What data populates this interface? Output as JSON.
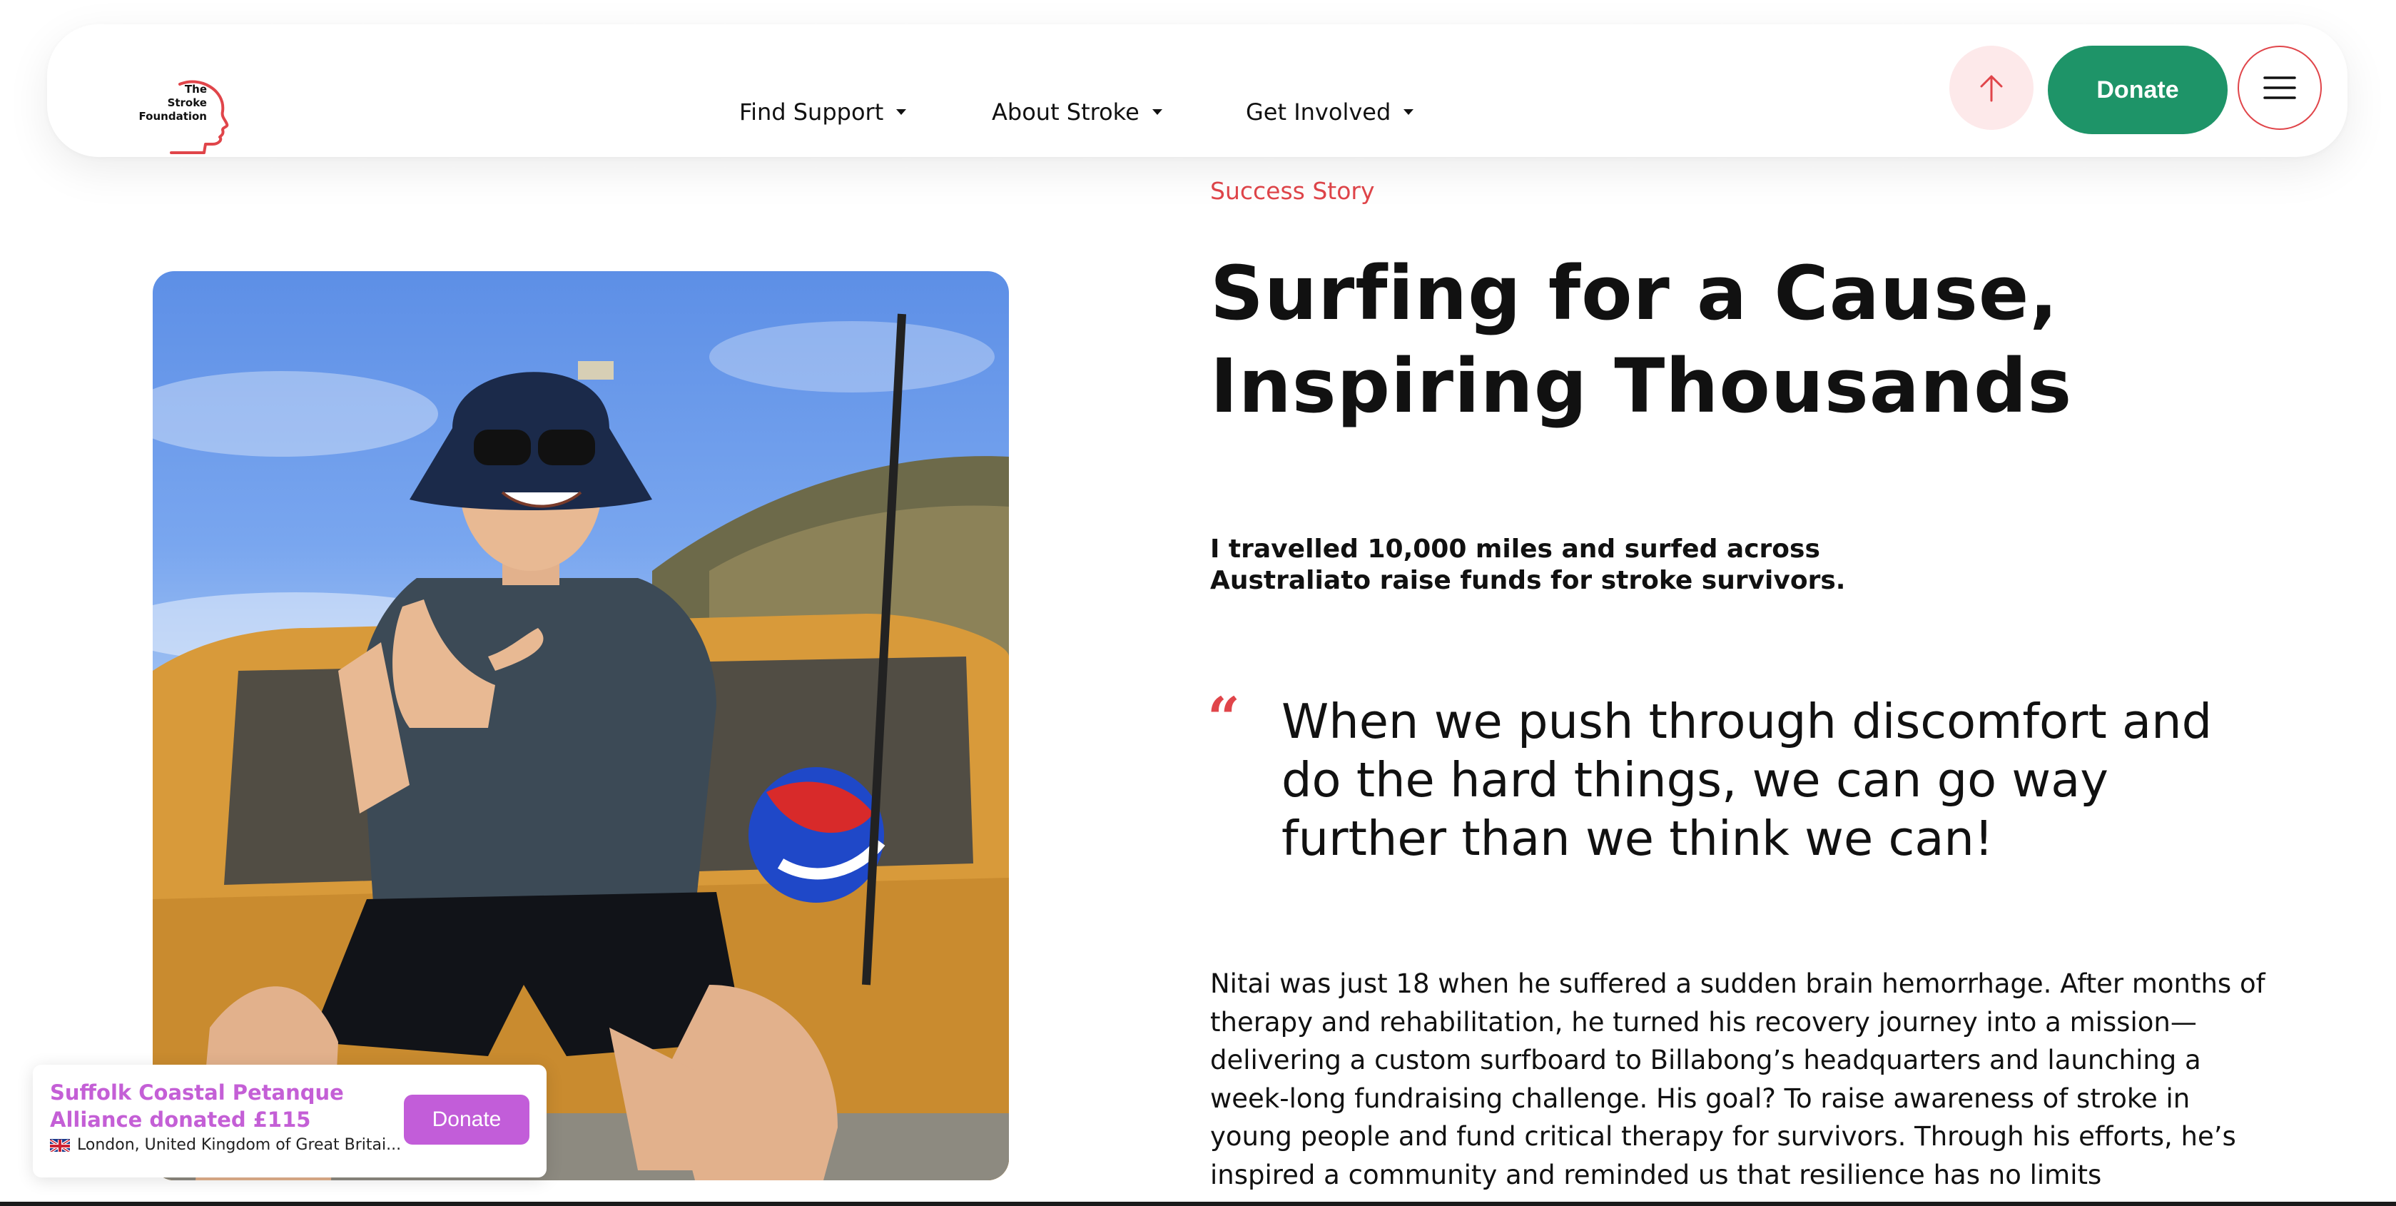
{
  "header": {
    "logo": {
      "lines": [
        "The",
        "Stroke",
        "Foundation"
      ]
    },
    "nav": [
      {
        "label": "Find Support"
      },
      {
        "label": "About Stroke"
      },
      {
        "label": "Get Involved"
      }
    ],
    "donate_label": "Donate"
  },
  "article": {
    "eyebrow": "Success Story",
    "title": "Surfing for a Cause, Inspiring Thousands",
    "lead": "I travelled 10,000 miles and surfed across Australiato raise funds for stroke survivors.",
    "quote_mark": "“",
    "quote": "When we push through discomfort and do the hard things, we can go way further than we think we can!",
    "body": "Nitai was just 18 when he suffered a sudden brain hemorrhage. After months of therapy and rehabilitation, he turned his recovery journey into a mission—delivering a custom surfboard to Billabong’s headquarters and launching a week-long fundraising challenge. His goal? To raise awareness of stroke in young people and fund critical therapy for survivors. Through his efforts, he’s inspired a community and reminded us that resilience has no limits"
  },
  "toast": {
    "title": "Suffolk Coastal Petanque Alliance donated £115",
    "location": "London, United Kingdom of Great Britai...",
    "donate_label": "Donate"
  },
  "colors": {
    "accent_red": "#e0454a",
    "donate_green": "#1e9468",
    "toast_purple": "#c25dd9",
    "up_button_bg": "#fde9ea"
  },
  "icons": {
    "up": "arrow-up-icon",
    "menu": "hamburger-menu-icon",
    "logo_head": "head-profile-icon",
    "flag": "uk-flag-icon"
  }
}
